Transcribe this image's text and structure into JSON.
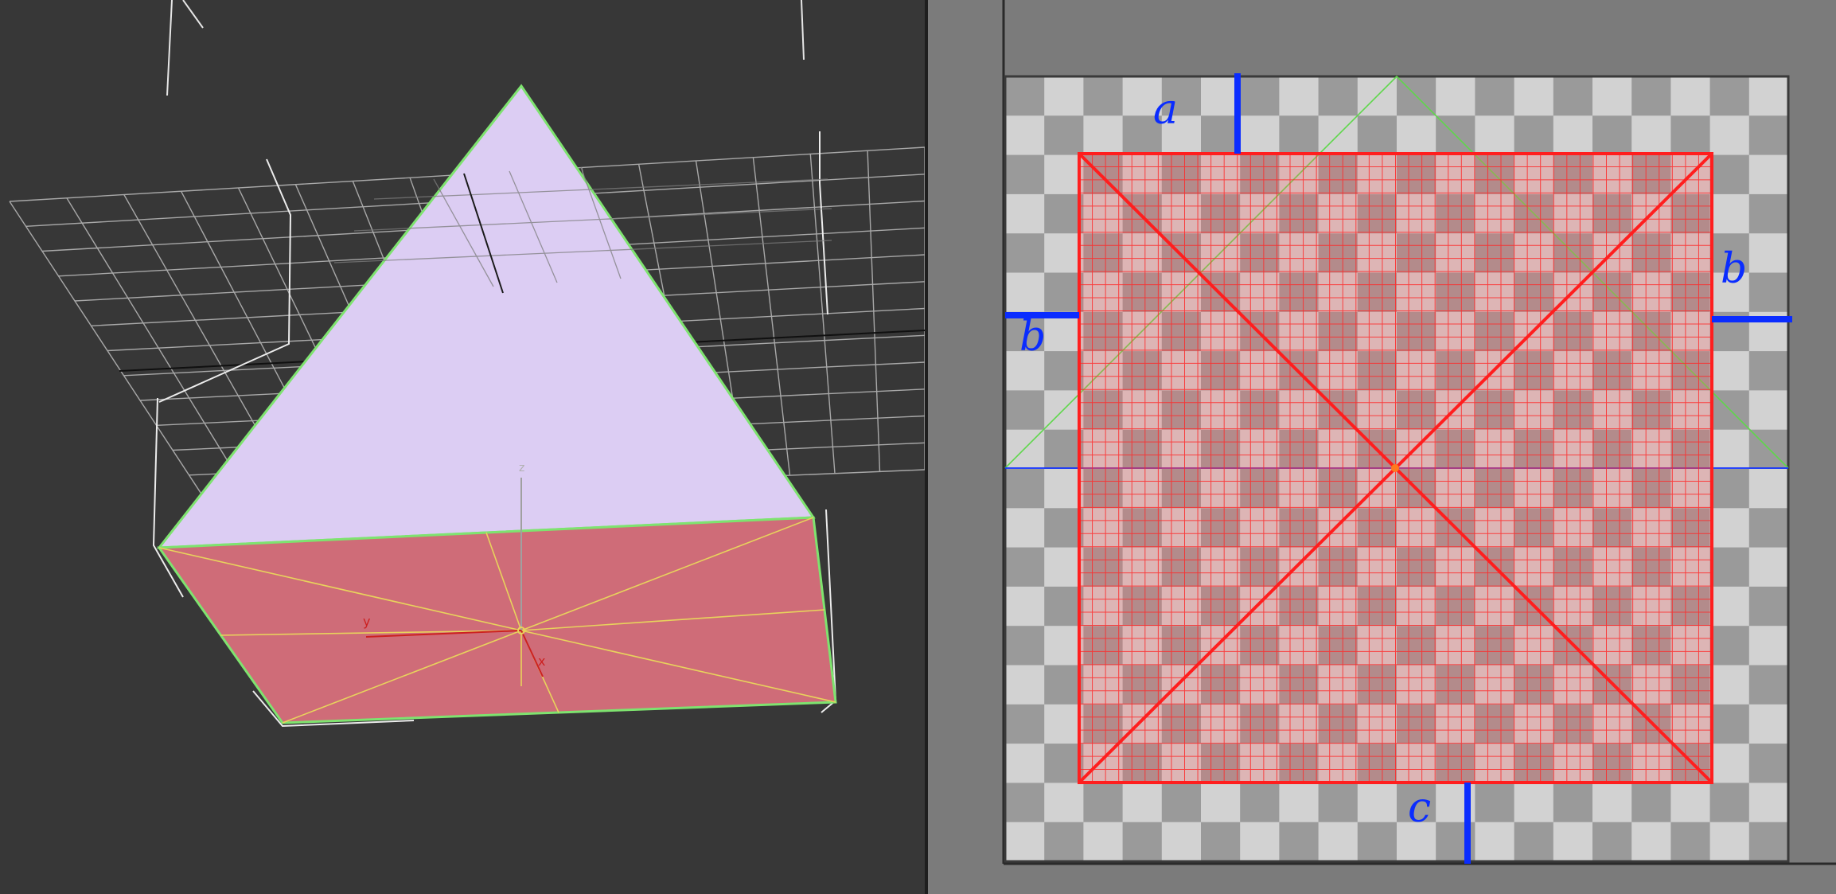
{
  "viewport3d": {
    "gizmo": {
      "z_label": "z",
      "y_label": "y",
      "x_label": "x"
    },
    "colors": {
      "background": "#373737",
      "top_face": "#dccdf3",
      "bottom_face": "#cf6c78",
      "edge_highlight": "#7ee36f",
      "triangulation": "#e8d35c",
      "grid": "#a8a8a8"
    }
  },
  "uv_editor": {
    "labels": {
      "top": "a",
      "left": "b",
      "right": "b",
      "bottom": "c"
    },
    "colors": {
      "checker_light": "#d2d2d2",
      "checker_dark": "#9a9a9a",
      "selection": "#ff1e1e",
      "marker": "#0a2cff",
      "green_guide": "#5fd74b",
      "axis_line": "#1030ff"
    }
  }
}
